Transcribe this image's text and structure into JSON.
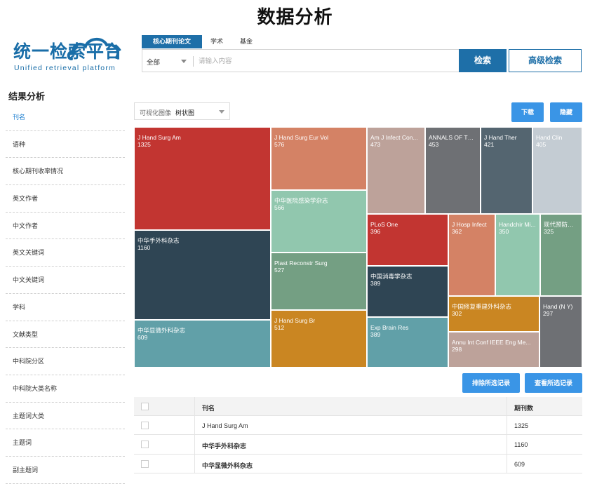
{
  "page_title": "数据分析",
  "logo": {
    "cn": "统一检索平台",
    "en": "Unified retrieval platform"
  },
  "search": {
    "tabs": [
      "核心期刊论文",
      "学术",
      "基金"
    ],
    "scope": "全部",
    "placeholder": "请输入内容",
    "search_label": "检索",
    "advanced_label": "高级检索"
  },
  "sidebar": {
    "title": "结果分析",
    "items": [
      "刊名",
      "语种",
      "核心期刊收率情况",
      "英文作者",
      "中文作者",
      "英文关键词",
      "中文关键词",
      "学科",
      "文献类型",
      "中科院分区",
      "中科院大类名称",
      "主题词大类",
      "主题词",
      "副主题词"
    ]
  },
  "viz": {
    "label": "可视化图像",
    "value": "树状图"
  },
  "buttons": {
    "download": "下载",
    "hide": "隐藏",
    "exclude": "排除所选记录",
    "view": "查看所选记录"
  },
  "treemap": [
    {
      "name": "J Hand Surg Am",
      "value": "1325",
      "color": "#c23531"
    },
    {
      "name": "中华手外科杂志",
      "value": "1160",
      "color": "#2f4554"
    },
    {
      "name": "中华显微外科杂志",
      "value": "609",
      "color": "#61a0a8"
    },
    {
      "name": "J Hand Surg Eur Vol",
      "value": "576",
      "color": "#d48265"
    },
    {
      "name": "中华医院感染学杂志",
      "value": "566",
      "color": "#91c7ae"
    },
    {
      "name": "Plast Reconstr Surg",
      "value": "527",
      "color": "#749f83"
    },
    {
      "name": "J Hand Surg Br",
      "value": "512",
      "color": "#ca8622"
    },
    {
      "name": "Am J Infect Con...",
      "value": "473",
      "color": "#bda29a"
    },
    {
      "name": "ANNALS OF THE...",
      "value": "453",
      "color": "#6e7074"
    },
    {
      "name": "J Hand Ther",
      "value": "421",
      "color": "#546570"
    },
    {
      "name": "Hand Clin",
      "value": "405",
      "color": "#c4ccd3"
    },
    {
      "name": "PLoS One",
      "value": "396",
      "color": "#c23531"
    },
    {
      "name": "中国消毒学杂志",
      "value": "389",
      "color": "#2f4554"
    },
    {
      "name": "Exp Brain Res",
      "value": "389",
      "color": "#61a0a8"
    },
    {
      "name": "J Hosp Infect",
      "value": "362",
      "color": "#d48265"
    },
    {
      "name": "Handchir Mi...",
      "value": "350",
      "color": "#91c7ae"
    },
    {
      "name": "现代预防医学",
      "value": "325",
      "color": "#749f83"
    },
    {
      "name": "中国修复重建外科杂志",
      "value": "302",
      "color": "#ca8622"
    },
    {
      "name": "Annu Int Conf IEEE Eng Me...",
      "value": "298",
      "color": "#bda29a"
    },
    {
      "name": "Hand (N Y)",
      "value": "297",
      "color": "#6e7074"
    }
  ],
  "table": {
    "headers": [
      "刊名",
      "期刊数"
    ],
    "rows": [
      {
        "name": "J Hand Surg Am",
        "count": "1325"
      },
      {
        "name": "中华手外科杂志",
        "count": "1160"
      },
      {
        "name": "中华显微外科杂志",
        "count": "609"
      }
    ]
  }
}
